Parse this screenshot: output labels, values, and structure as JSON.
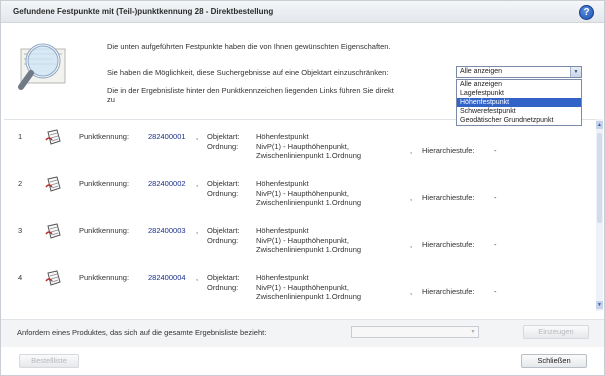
{
  "dialog": {
    "title": "Gefundene Festpunkte mit (Teil-)punktkennung 28 - Direktbestellung",
    "help_icon": "question-icon",
    "help_glyph": "?"
  },
  "intro": {
    "line1": "Die unten aufgeführten Festpunkte haben die von Ihnen gewünschten Eigenschaften.",
    "line2": "Sie haben die Möglichkeit, diese Suchergebnisse auf eine Objektart einzuschränken:",
    "line3a": "Die in der Ergebnisliste hinter den Punktkennzeichen liegenden Links führen Sie direkt",
    "line3b": "zu"
  },
  "filter": {
    "selected": "Alle anzeigen",
    "options": [
      "Alle anzeigen",
      "Lagefestpunkt",
      "Höhenfestpunkt",
      "Schwerefestpunkt",
      "Geodätischer Grundnetzpunkt"
    ],
    "highlighted_index": 2
  },
  "labels": {
    "punktkennung": "Punktkennung:",
    "objektart": "Objektart:",
    "ordnung": "Ordnung:",
    "hierarchiestufe": "Hierarchiestufe:",
    "comma": ","
  },
  "results": [
    {
      "num": "1",
      "punktkennung": "282400001",
      "objektart": "Höhenfestpunkt",
      "ordnung_1": "NivP(1) - Haupthöhenpunkt,",
      "ordnung_2": "Zwischenlinienpunkt 1.Ordnung",
      "hierarchiestufe": "-"
    },
    {
      "num": "2",
      "punktkennung": "282400002",
      "objektart": "Höhenfestpunkt",
      "ordnung_1": "NivP(1) - Haupthöhenpunkt,",
      "ordnung_2": "Zwischenlinienpunkt 1.Ordnung",
      "hierarchiestufe": "-"
    },
    {
      "num": "3",
      "punktkennung": "282400003",
      "objektart": "Höhenfestpunkt",
      "ordnung_1": "NivP(1) - Haupthöhenpunkt,",
      "ordnung_2": "Zwischenlinienpunkt 1.Ordnung",
      "hierarchiestufe": "-"
    },
    {
      "num": "4",
      "punktkennung": "282400004",
      "objektart": "Höhenfestpunkt",
      "ordnung_1": "NivP(1) - Haupthöhenpunkt,",
      "ordnung_2": "Zwischenlinienpunkt 1.Ordnung",
      "hierarchiestufe": "-"
    }
  ],
  "order": {
    "text": "Anfordern eines Produktes, das sich auf die gesamte Ergebnisliste bezieht:",
    "product_selected": "",
    "einzeugen_label": "Einzeugen"
  },
  "footer": {
    "bestellliste_label": "Bestellliste",
    "schliessen_label": "Schließen"
  },
  "colors": {
    "accent": "#3264c8",
    "link": "#1a2f8a"
  }
}
